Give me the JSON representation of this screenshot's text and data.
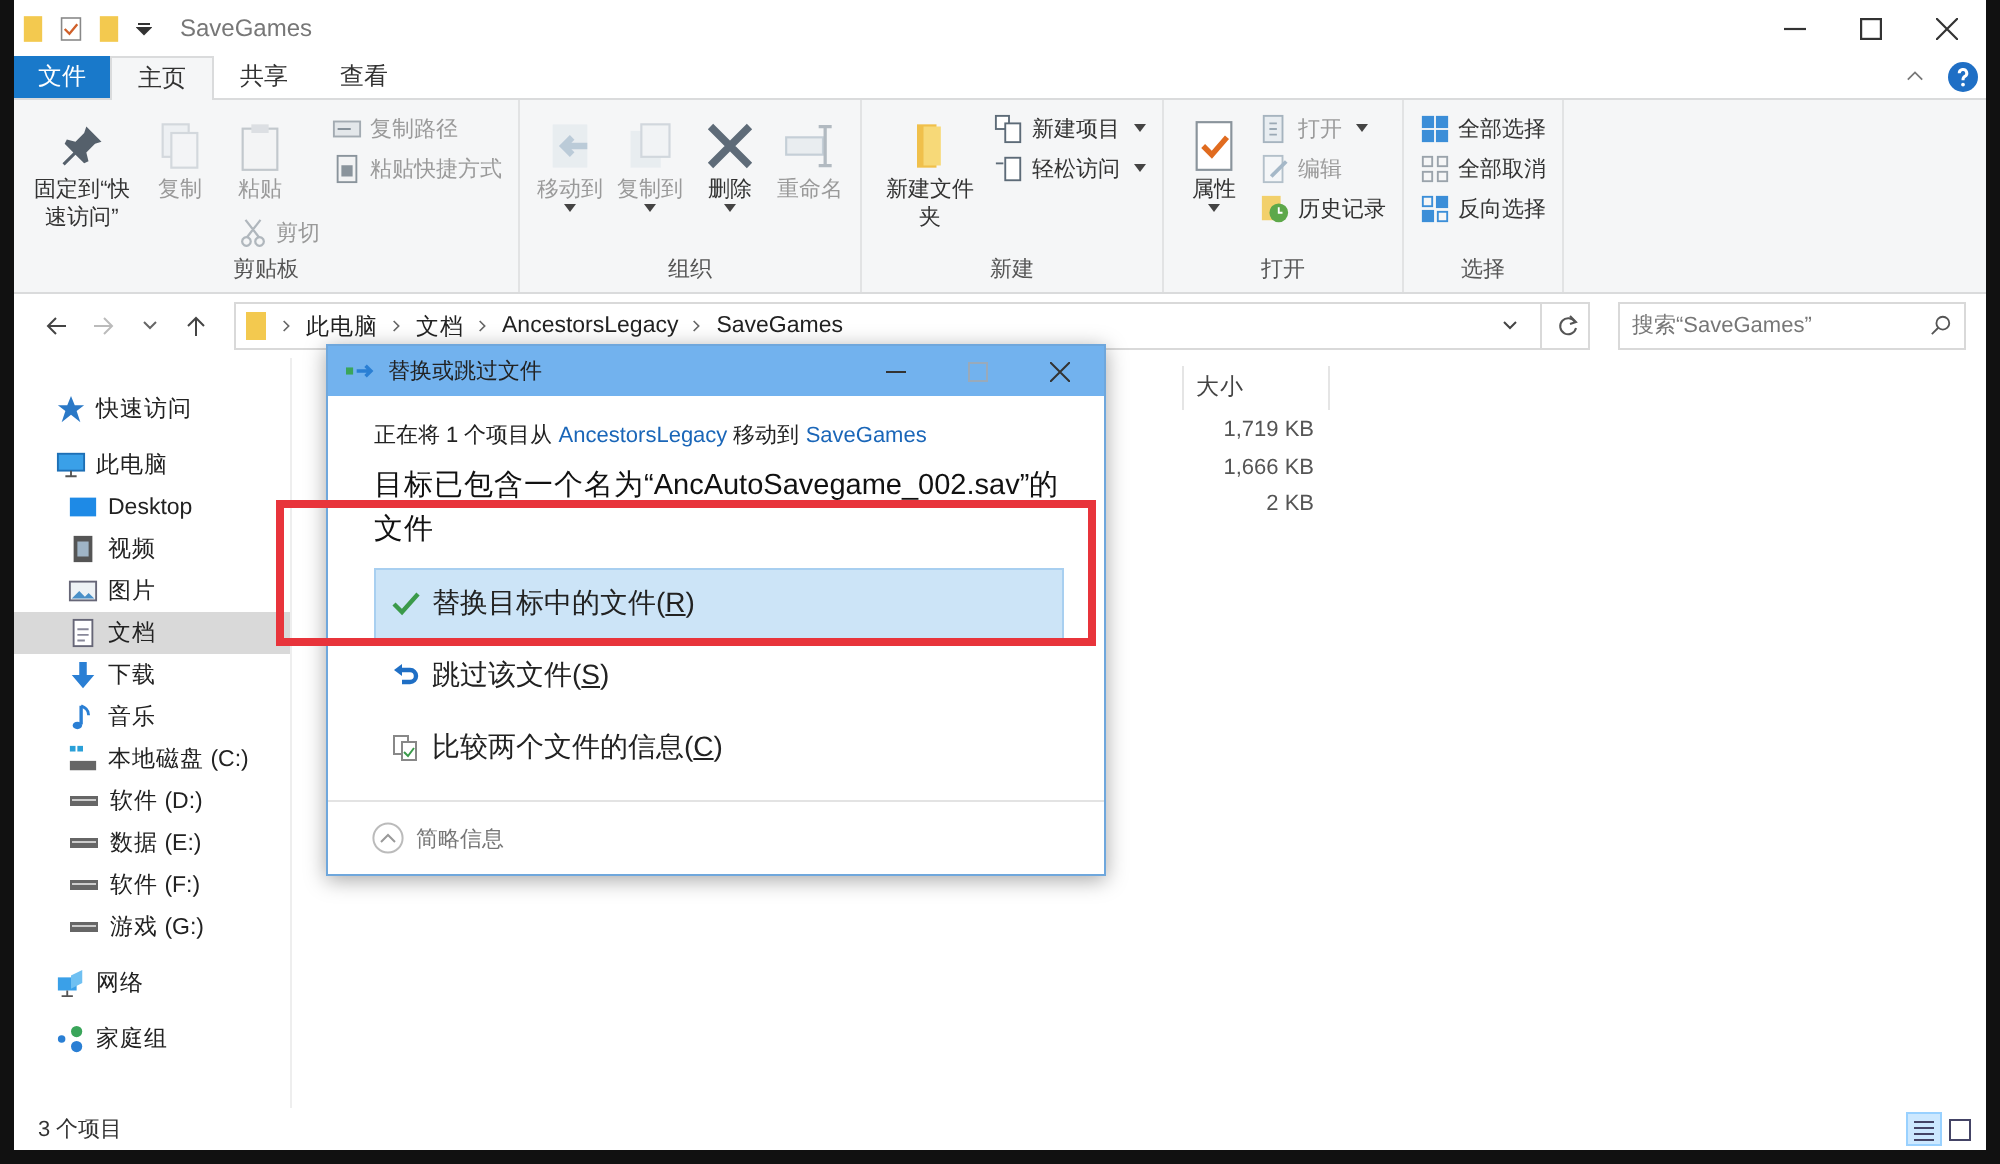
{
  "window": {
    "title": "SaveGames"
  },
  "tabs": [
    {
      "label": "文件",
      "kind": "file",
      "selected": false
    },
    {
      "label": "主页",
      "kind": "tab",
      "selected": true
    },
    {
      "label": "共享",
      "kind": "tab",
      "selected": false
    },
    {
      "label": "查看",
      "kind": "tab",
      "selected": false
    }
  ],
  "ribbon": {
    "groups": [
      {
        "label": "剪贴板",
        "columns": [
          [
            {
              "label": "固定到“快速访问”",
              "kind": "large",
              "disabled": false,
              "dropdown": false
            }
          ],
          [
            {
              "label": "复制",
              "kind": "large",
              "disabled": true,
              "dropdown": false
            }
          ],
          [
            {
              "label": "粘贴",
              "kind": "large",
              "disabled": true,
              "dropdown": false
            },
            {
              "label": "剪切",
              "kind": "small",
              "disabled": true,
              "dropdown": false
            }
          ],
          [
            {
              "label": "复制路径",
              "kind": "small",
              "disabled": true,
              "dropdown": false
            },
            {
              "label": "粘贴快捷方式",
              "kind": "small",
              "disabled": true,
              "dropdown": false
            }
          ]
        ]
      },
      {
        "label": "组织",
        "columns": [
          [
            {
              "label": "移动到",
              "kind": "large",
              "disabled": true,
              "dropdown": true
            }
          ],
          [
            {
              "label": "复制到",
              "kind": "large",
              "disabled": true,
              "dropdown": true
            }
          ],
          [
            {
              "label": "删除",
              "kind": "large",
              "disabled": false,
              "dropdown": true
            }
          ],
          [
            {
              "label": "重命名",
              "kind": "large",
              "disabled": true,
              "dropdown": false
            }
          ]
        ]
      },
      {
        "label": "新建",
        "columns": [
          [
            {
              "label": "新建文件夹",
              "kind": "large",
              "disabled": false,
              "dropdown": false
            }
          ],
          [
            {
              "label": "新建项目",
              "kind": "small",
              "disabled": false,
              "dropdown": true
            },
            {
              "label": "轻松访问",
              "kind": "small",
              "disabled": false,
              "dropdown": true
            }
          ]
        ]
      },
      {
        "label": "打开",
        "columns": [
          [
            {
              "label": "属性",
              "kind": "large",
              "disabled": false,
              "dropdown": true
            }
          ],
          [
            {
              "label": "打开",
              "kind": "small",
              "disabled": true,
              "dropdown": true
            },
            {
              "label": "编辑",
              "kind": "small",
              "disabled": true,
              "dropdown": false
            },
            {
              "label": "历史记录",
              "kind": "small",
              "disabled": false,
              "dropdown": false
            }
          ]
        ]
      },
      {
        "label": "选择",
        "columns": [
          [
            {
              "label": "全部选择",
              "kind": "small",
              "disabled": false,
              "dropdown": false
            },
            {
              "label": "全部取消",
              "kind": "small",
              "disabled": false,
              "dropdown": false
            },
            {
              "label": "反向选择",
              "kind": "small",
              "disabled": false,
              "dropdown": false
            }
          ]
        ]
      }
    ]
  },
  "address": {
    "crumbs": [
      "此电脑",
      "文档",
      "AncestorsLegacy",
      "SaveGames"
    ],
    "search_placeholder": "搜索“SaveGames”"
  },
  "sidebar": {
    "items": [
      {
        "label": "快速访问",
        "selected": false
      },
      {
        "label": "此电脑",
        "selected": false,
        "children": [
          {
            "label": "Desktop",
            "selected": false
          },
          {
            "label": "视频",
            "selected": false
          },
          {
            "label": "图片",
            "selected": false
          },
          {
            "label": "文档",
            "selected": true
          },
          {
            "label": "下载",
            "selected": false
          },
          {
            "label": "音乐",
            "selected": false
          },
          {
            "label": "本地磁盘 (C:)",
            "selected": false
          },
          {
            "label": "软件 (D:)",
            "selected": false
          },
          {
            "label": "数据 (E:)",
            "selected": false
          },
          {
            "label": "软件 (F:)",
            "selected": false
          },
          {
            "label": "游戏 (G:)",
            "selected": false
          }
        ]
      },
      {
        "label": "网络",
        "selected": false
      },
      {
        "label": "家庭组",
        "selected": false
      }
    ]
  },
  "file_list": {
    "columns": [
      "大小"
    ],
    "rows": [
      [
        "1,719 KB"
      ],
      [
        "1,666 KB"
      ],
      [
        "2 KB"
      ]
    ]
  },
  "dialog": {
    "title": "替换或跳过文件",
    "info": {
      "prefix": "正在将 1 个项目从 ",
      "source": "AncestorsLegacy",
      "middle": " 移动到 ",
      "destination": "SaveGames"
    },
    "heading": "目标已包含一个名为“AncAutoSavegame_002.sav”的文件",
    "options": [
      {
        "kind": "replace",
        "before": "替换目标中的文件(",
        "key": "R",
        "after": ")",
        "selected": true
      },
      {
        "kind": "skip",
        "before": "跳过该文件(",
        "key": "S",
        "after": ")",
        "selected": false
      },
      {
        "kind": "compare",
        "before": "比较两个文件的信息(",
        "key": "C",
        "after": ")",
        "selected": false
      }
    ],
    "footer": "简略信息"
  },
  "highlight": {
    "shown": true
  },
  "status_bar": {
    "text": "3 个项目",
    "views": [
      {
        "kind": "details",
        "selected": true
      },
      {
        "kind": "tiles",
        "selected": false
      }
    ]
  }
}
